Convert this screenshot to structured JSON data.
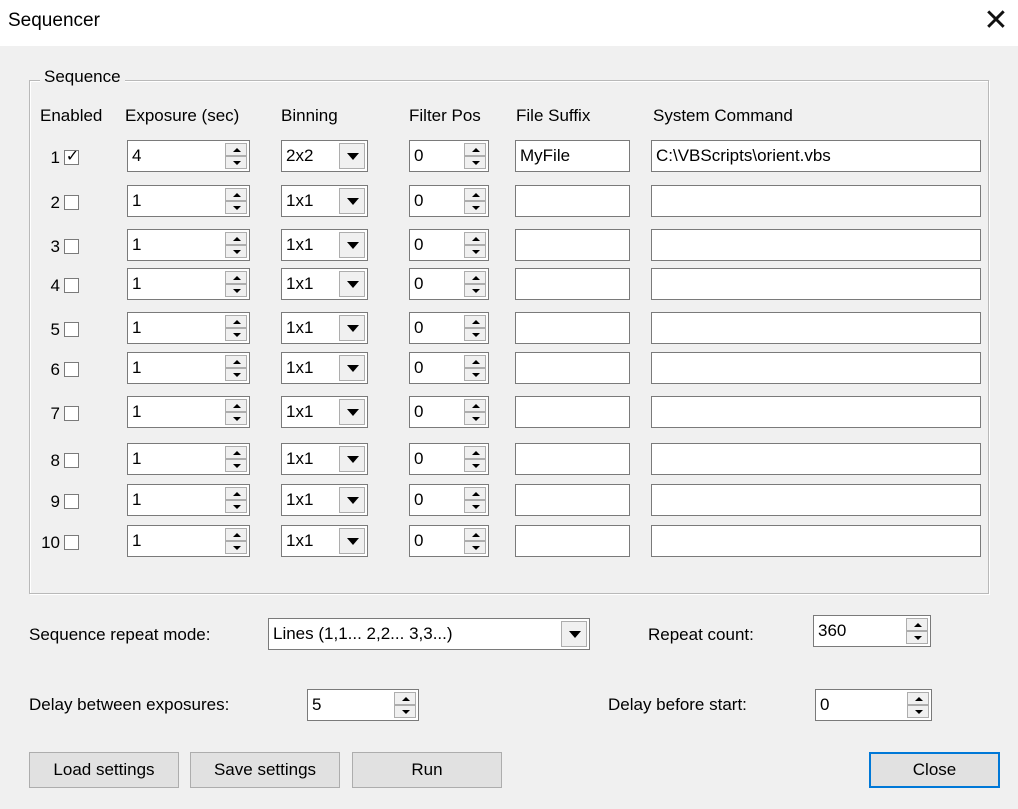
{
  "window": {
    "title": "Sequencer"
  },
  "group": {
    "legend": "Sequence"
  },
  "headers": {
    "enabled": "Enabled",
    "exposure": "Exposure (sec)",
    "binning": "Binning",
    "filter_pos": "Filter Pos",
    "file_suffix": "File Suffix",
    "system_command": "System Command"
  },
  "rows": [
    {
      "num": "1",
      "enabled": true,
      "exposure": "4",
      "binning": "2x2",
      "filter_pos": "0",
      "file_suffix": "MyFile",
      "system_command": "C:\\VBScripts\\orient.vbs"
    },
    {
      "num": "2",
      "enabled": false,
      "exposure": "1",
      "binning": "1x1",
      "filter_pos": "0",
      "file_suffix": "",
      "system_command": ""
    },
    {
      "num": "3",
      "enabled": false,
      "exposure": "1",
      "binning": "1x1",
      "filter_pos": "0",
      "file_suffix": "",
      "system_command": ""
    },
    {
      "num": "4",
      "enabled": false,
      "exposure": "1",
      "binning": "1x1",
      "filter_pos": "0",
      "file_suffix": "",
      "system_command": ""
    },
    {
      "num": "5",
      "enabled": false,
      "exposure": "1",
      "binning": "1x1",
      "filter_pos": "0",
      "file_suffix": "",
      "system_command": ""
    },
    {
      "num": "6",
      "enabled": false,
      "exposure": "1",
      "binning": "1x1",
      "filter_pos": "0",
      "file_suffix": "",
      "system_command": ""
    },
    {
      "num": "7",
      "enabled": false,
      "exposure": "1",
      "binning": "1x1",
      "filter_pos": "0",
      "file_suffix": "",
      "system_command": ""
    },
    {
      "num": "8",
      "enabled": false,
      "exposure": "1",
      "binning": "1x1",
      "filter_pos": "0",
      "file_suffix": "",
      "system_command": ""
    },
    {
      "num": "9",
      "enabled": false,
      "exposure": "1",
      "binning": "1x1",
      "filter_pos": "0",
      "file_suffix": "",
      "system_command": ""
    },
    {
      "num": "10",
      "enabled": false,
      "exposure": "1",
      "binning": "1x1",
      "filter_pos": "0",
      "file_suffix": "",
      "system_command": ""
    }
  ],
  "repeat_mode": {
    "label": "Sequence repeat mode:",
    "value": "Lines (1,1... 2,2... 3,3...)"
  },
  "repeat_count": {
    "label": "Repeat count:",
    "value": "360"
  },
  "delay_between": {
    "label": "Delay between exposures:",
    "value": "5"
  },
  "delay_before": {
    "label": "Delay before start:",
    "value": "0"
  },
  "buttons": {
    "load": "Load settings",
    "save": "Save settings",
    "run": "Run",
    "close": "Close"
  },
  "icons": {
    "close": "close-icon",
    "check": "checkmark-icon",
    "spin_up": "spin-up-icon",
    "spin_down": "spin-down-icon",
    "dropdown": "chevron-down-icon"
  }
}
